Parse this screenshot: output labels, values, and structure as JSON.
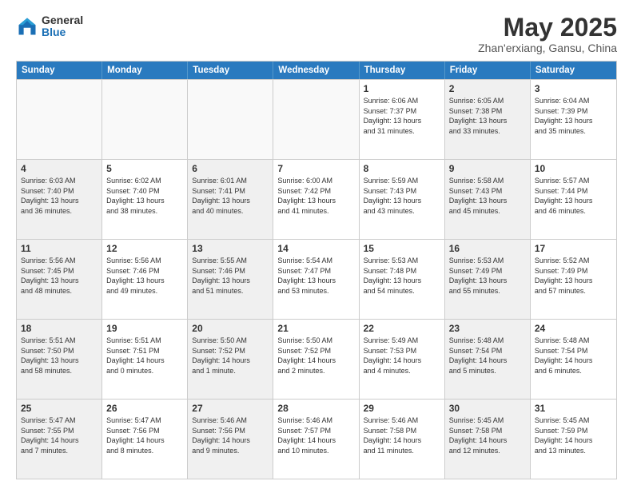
{
  "header": {
    "logo_general": "General",
    "logo_blue": "Blue",
    "month": "May 2025",
    "location": "Zhan'erxiang, Gansu, China"
  },
  "weekdays": [
    "Sunday",
    "Monday",
    "Tuesday",
    "Wednesday",
    "Thursday",
    "Friday",
    "Saturday"
  ],
  "rows": [
    [
      {
        "day": "",
        "info": "",
        "shaded": false,
        "empty": true
      },
      {
        "day": "",
        "info": "",
        "shaded": false,
        "empty": true
      },
      {
        "day": "",
        "info": "",
        "shaded": false,
        "empty": true
      },
      {
        "day": "",
        "info": "",
        "shaded": false,
        "empty": true
      },
      {
        "day": "1",
        "info": "Sunrise: 6:06 AM\nSunset: 7:37 PM\nDaylight: 13 hours\nand 31 minutes.",
        "shaded": false,
        "empty": false
      },
      {
        "day": "2",
        "info": "Sunrise: 6:05 AM\nSunset: 7:38 PM\nDaylight: 13 hours\nand 33 minutes.",
        "shaded": true,
        "empty": false
      },
      {
        "day": "3",
        "info": "Sunrise: 6:04 AM\nSunset: 7:39 PM\nDaylight: 13 hours\nand 35 minutes.",
        "shaded": false,
        "empty": false
      }
    ],
    [
      {
        "day": "4",
        "info": "Sunrise: 6:03 AM\nSunset: 7:40 PM\nDaylight: 13 hours\nand 36 minutes.",
        "shaded": true,
        "empty": false
      },
      {
        "day": "5",
        "info": "Sunrise: 6:02 AM\nSunset: 7:40 PM\nDaylight: 13 hours\nand 38 minutes.",
        "shaded": false,
        "empty": false
      },
      {
        "day": "6",
        "info": "Sunrise: 6:01 AM\nSunset: 7:41 PM\nDaylight: 13 hours\nand 40 minutes.",
        "shaded": true,
        "empty": false
      },
      {
        "day": "7",
        "info": "Sunrise: 6:00 AM\nSunset: 7:42 PM\nDaylight: 13 hours\nand 41 minutes.",
        "shaded": false,
        "empty": false
      },
      {
        "day": "8",
        "info": "Sunrise: 5:59 AM\nSunset: 7:43 PM\nDaylight: 13 hours\nand 43 minutes.",
        "shaded": false,
        "empty": false
      },
      {
        "day": "9",
        "info": "Sunrise: 5:58 AM\nSunset: 7:43 PM\nDaylight: 13 hours\nand 45 minutes.",
        "shaded": true,
        "empty": false
      },
      {
        "day": "10",
        "info": "Sunrise: 5:57 AM\nSunset: 7:44 PM\nDaylight: 13 hours\nand 46 minutes.",
        "shaded": false,
        "empty": false
      }
    ],
    [
      {
        "day": "11",
        "info": "Sunrise: 5:56 AM\nSunset: 7:45 PM\nDaylight: 13 hours\nand 48 minutes.",
        "shaded": true,
        "empty": false
      },
      {
        "day": "12",
        "info": "Sunrise: 5:56 AM\nSunset: 7:46 PM\nDaylight: 13 hours\nand 49 minutes.",
        "shaded": false,
        "empty": false
      },
      {
        "day": "13",
        "info": "Sunrise: 5:55 AM\nSunset: 7:46 PM\nDaylight: 13 hours\nand 51 minutes.",
        "shaded": true,
        "empty": false
      },
      {
        "day": "14",
        "info": "Sunrise: 5:54 AM\nSunset: 7:47 PM\nDaylight: 13 hours\nand 53 minutes.",
        "shaded": false,
        "empty": false
      },
      {
        "day": "15",
        "info": "Sunrise: 5:53 AM\nSunset: 7:48 PM\nDaylight: 13 hours\nand 54 minutes.",
        "shaded": false,
        "empty": false
      },
      {
        "day": "16",
        "info": "Sunrise: 5:53 AM\nSunset: 7:49 PM\nDaylight: 13 hours\nand 55 minutes.",
        "shaded": true,
        "empty": false
      },
      {
        "day": "17",
        "info": "Sunrise: 5:52 AM\nSunset: 7:49 PM\nDaylight: 13 hours\nand 57 minutes.",
        "shaded": false,
        "empty": false
      }
    ],
    [
      {
        "day": "18",
        "info": "Sunrise: 5:51 AM\nSunset: 7:50 PM\nDaylight: 13 hours\nand 58 minutes.",
        "shaded": true,
        "empty": false
      },
      {
        "day": "19",
        "info": "Sunrise: 5:51 AM\nSunset: 7:51 PM\nDaylight: 14 hours\nand 0 minutes.",
        "shaded": false,
        "empty": false
      },
      {
        "day": "20",
        "info": "Sunrise: 5:50 AM\nSunset: 7:52 PM\nDaylight: 14 hours\nand 1 minute.",
        "shaded": true,
        "empty": false
      },
      {
        "day": "21",
        "info": "Sunrise: 5:50 AM\nSunset: 7:52 PM\nDaylight: 14 hours\nand 2 minutes.",
        "shaded": false,
        "empty": false
      },
      {
        "day": "22",
        "info": "Sunrise: 5:49 AM\nSunset: 7:53 PM\nDaylight: 14 hours\nand 4 minutes.",
        "shaded": false,
        "empty": false
      },
      {
        "day": "23",
        "info": "Sunrise: 5:48 AM\nSunset: 7:54 PM\nDaylight: 14 hours\nand 5 minutes.",
        "shaded": true,
        "empty": false
      },
      {
        "day": "24",
        "info": "Sunrise: 5:48 AM\nSunset: 7:54 PM\nDaylight: 14 hours\nand 6 minutes.",
        "shaded": false,
        "empty": false
      }
    ],
    [
      {
        "day": "25",
        "info": "Sunrise: 5:47 AM\nSunset: 7:55 PM\nDaylight: 14 hours\nand 7 minutes.",
        "shaded": true,
        "empty": false
      },
      {
        "day": "26",
        "info": "Sunrise: 5:47 AM\nSunset: 7:56 PM\nDaylight: 14 hours\nand 8 minutes.",
        "shaded": false,
        "empty": false
      },
      {
        "day": "27",
        "info": "Sunrise: 5:46 AM\nSunset: 7:56 PM\nDaylight: 14 hours\nand 9 minutes.",
        "shaded": true,
        "empty": false
      },
      {
        "day": "28",
        "info": "Sunrise: 5:46 AM\nSunset: 7:57 PM\nDaylight: 14 hours\nand 10 minutes.",
        "shaded": false,
        "empty": false
      },
      {
        "day": "29",
        "info": "Sunrise: 5:46 AM\nSunset: 7:58 PM\nDaylight: 14 hours\nand 11 minutes.",
        "shaded": false,
        "empty": false
      },
      {
        "day": "30",
        "info": "Sunrise: 5:45 AM\nSunset: 7:58 PM\nDaylight: 14 hours\nand 12 minutes.",
        "shaded": true,
        "empty": false
      },
      {
        "day": "31",
        "info": "Sunrise: 5:45 AM\nSunset: 7:59 PM\nDaylight: 14 hours\nand 13 minutes.",
        "shaded": false,
        "empty": false
      }
    ]
  ]
}
